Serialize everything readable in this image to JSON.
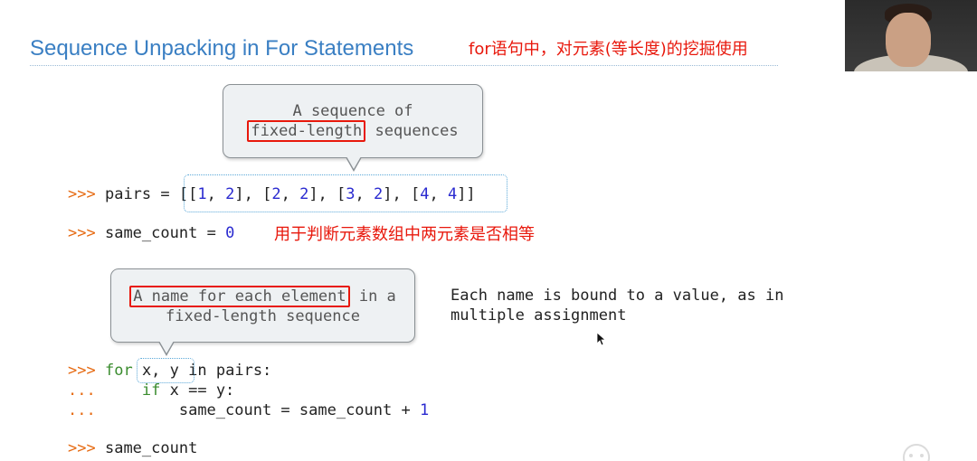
{
  "slide": {
    "title": "Sequence Unpacking in For Statements",
    "title_annotation": "for语句中，对元素(等长度)的挖掘使用"
  },
  "callout_top": {
    "line1": "A sequence of",
    "line2_boxed": "fixed-length",
    "line2_rest": " sequences"
  },
  "callout_bottom": {
    "line1_boxed": "A name for each element",
    "line1_rest": " in a",
    "line2": "fixed-length sequence"
  },
  "note": {
    "line1": "Each name is bound to a value, as in",
    "line2": "multiple assignment"
  },
  "code": {
    "prompt": ">>>",
    "continuation": "...",
    "line1": {
      "name": "pairs",
      "op": "=",
      "open": "[[",
      "items": [
        {
          "a": "1",
          "b": "2"
        },
        {
          "a": "2",
          "b": "2"
        },
        {
          "a": "3",
          "b": "2"
        },
        {
          "a": "4",
          "b": "4"
        }
      ],
      "close": "]]"
    },
    "line2": {
      "name": "same_count",
      "op": "=",
      "value": "0"
    },
    "line2_annotation": "用于判断元素数组中两元素是否相等",
    "line3": {
      "kw_for": "for",
      "targets": "x, y",
      "kw_in": "in",
      "iter": "pairs:"
    },
    "line4": {
      "kw_if": "if",
      "cond": "x == y:"
    },
    "line5": {
      "text": "same_count = same_count +",
      "num": "1"
    },
    "line6": {
      "text": "same_count"
    }
  },
  "icons": [
    "mouse-cursor-icon",
    "video-overlay-icon"
  ],
  "colors": {
    "title": "#3a7fc3",
    "annotation": "#e8180c",
    "prompt": "#e66a12",
    "keyword": "#3a8c2e",
    "number": "#2a2ad0"
  }
}
